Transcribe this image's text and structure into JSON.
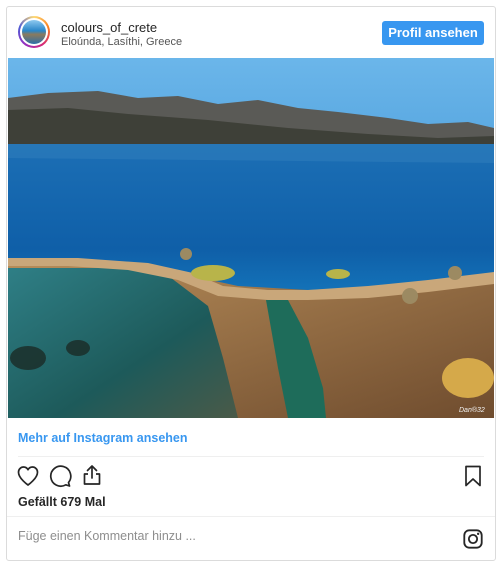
{
  "post": {
    "username": "colours_of_crete",
    "location": "Eloúnda, Lasíthi, Greece",
    "profile_button": "Profil ansehen",
    "photo_credit": "Dan®32",
    "more_link": "Mehr auf Instagram ansehen",
    "likes": "Gefällt 679 Mal",
    "comment_placeholder": "Füge einen Kommentar hinzu ..."
  },
  "icons": {
    "like": "heart-icon",
    "comment": "comment-icon",
    "share": "share-icon",
    "save": "bookmark-icon",
    "brand": "instagram-icon"
  },
  "colors": {
    "accent": "#3897f0",
    "text": "#262626",
    "muted": "#8e8e8e",
    "border": "#dbdbdb"
  }
}
